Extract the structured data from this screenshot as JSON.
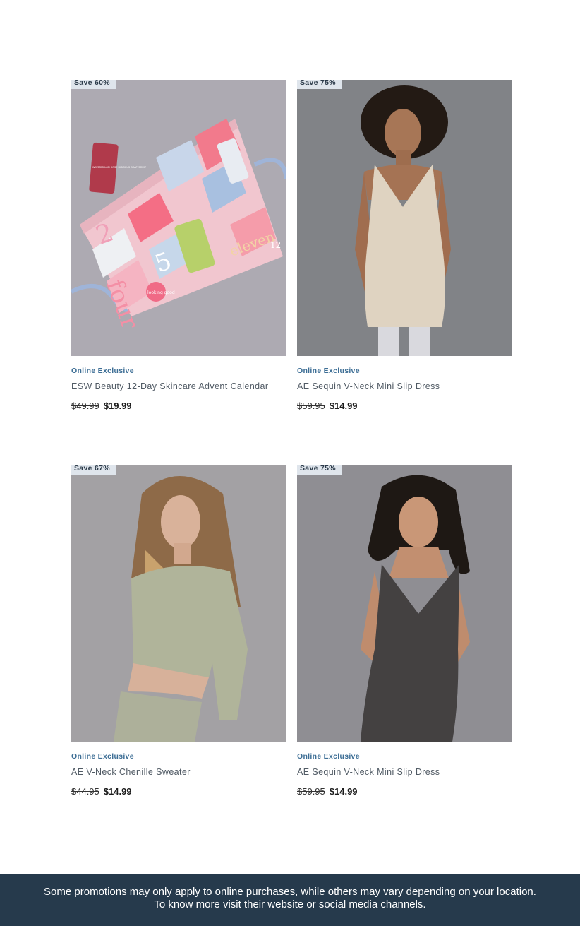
{
  "products": [
    {
      "badge": "Save 60%",
      "exclusive": "Online Exclusive",
      "title": "ESW Beauty 12-Day Skincare Advent Calendar",
      "old_price": "$49.99",
      "new_price": "$19.99",
      "calendar_text": {
        "two": "2",
        "four": "four",
        "five": "5",
        "eleven": "eleven",
        "twelve": "12",
        "looking_good": "looking good",
        "mask_label": "WATERMELON ROSE HIBISCUS GRAPEFRUIT"
      }
    },
    {
      "badge": "Save 75%",
      "exclusive": "Online Exclusive",
      "title": "AE Sequin V-Neck Mini Slip Dress",
      "old_price": "$59.95",
      "new_price": "$14.99"
    },
    {
      "badge": "Save 67%",
      "exclusive": "Online Exclusive",
      "title": "AE V-Neck Chenille Sweater",
      "old_price": "$44.95",
      "new_price": "$14.99"
    },
    {
      "badge": "Save 75%",
      "exclusive": "Online Exclusive",
      "title": "AE Sequin V-Neck Mini Slip Dress",
      "old_price": "$59.95",
      "new_price": "$14.99"
    }
  ],
  "footer": {
    "line1": "Some promotions may only apply to online purchases, while others may vary depending on your location.",
    "line2": "To know more visit their website or social media channels."
  }
}
